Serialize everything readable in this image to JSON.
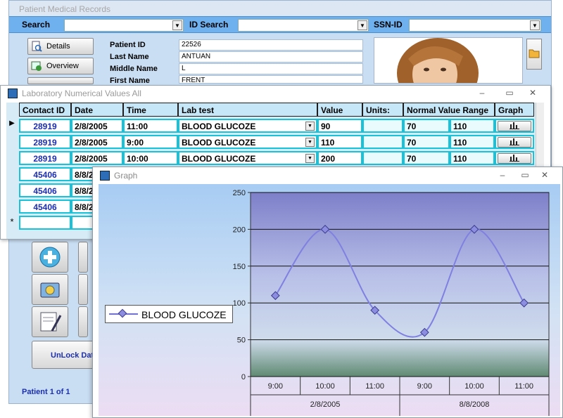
{
  "back_window": {
    "title": "Patient Medical Records",
    "search_label": "Search",
    "id_search_label": "ID Search",
    "ssn_label": "SSN-ID",
    "nav": {
      "details": "Details",
      "overview": "Overview"
    },
    "fields": [
      {
        "label": "Patient ID",
        "value": "22526"
      },
      {
        "label": "Last Name",
        "value": "ANTUAN"
      },
      {
        "label": "Middle Name",
        "value": "L"
      },
      {
        "label": "First Name",
        "value": "FRENT"
      }
    ],
    "unlock_label": "UnLock Data",
    "patient_count": "Patient 1 of 1"
  },
  "lab_window": {
    "title": "Laboratory Numerical Values All",
    "columns": [
      "Contact ID",
      "Date",
      "Time",
      "Lab test",
      "Value",
      "Units:",
      "Normal Value Range",
      "Graph"
    ],
    "rows": [
      {
        "contact_id": "28919",
        "date": "2/8/2005",
        "time": "11:00",
        "lab_test": "BLOOD GLUCOZE",
        "value": "90",
        "units": "",
        "range_low": "70",
        "range_high": "110"
      },
      {
        "contact_id": "28919",
        "date": "2/8/2005",
        "time": "9:00",
        "lab_test": "BLOOD GLUCOZE",
        "value": "110",
        "units": "",
        "range_low": "70",
        "range_high": "110"
      },
      {
        "contact_id": "28919",
        "date": "2/8/2005",
        "time": "10:00",
        "lab_test": "BLOOD GLUCOZE",
        "value": "200",
        "units": "",
        "range_low": "70",
        "range_high": "110"
      },
      {
        "contact_id": "45406",
        "date": "8/8/2"
      },
      {
        "contact_id": "45406",
        "date": "8/8/2"
      },
      {
        "contact_id": "45406",
        "date": "8/8/2"
      }
    ],
    "new_row_marker": "*"
  },
  "graph_window": {
    "title": "Graph",
    "legend": "BLOOD GLUCOZE"
  },
  "chart_data": {
    "type": "line",
    "title": "",
    "xlabel": "",
    "ylabel": "",
    "ylim": [
      0,
      250
    ],
    "yticks": [
      0,
      50,
      100,
      150,
      200,
      250
    ],
    "grid": true,
    "legend_position": "left",
    "categories": [
      "9:00",
      "10:00",
      "11:00",
      "9:00",
      "10:00",
      "11:00"
    ],
    "group_labels": [
      "2/8/2005",
      "8/8/2008"
    ],
    "series": [
      {
        "name": "BLOOD GLUCOZE",
        "values": [
          110,
          200,
          90,
          60,
          200,
          100
        ],
        "color": "#8080e0"
      }
    ]
  },
  "colors": {
    "accent": "#1c2fb0",
    "grid_border": "#18c3da",
    "header_bg": "#c5e7f7",
    "search_bar": "#6fb0ee"
  }
}
